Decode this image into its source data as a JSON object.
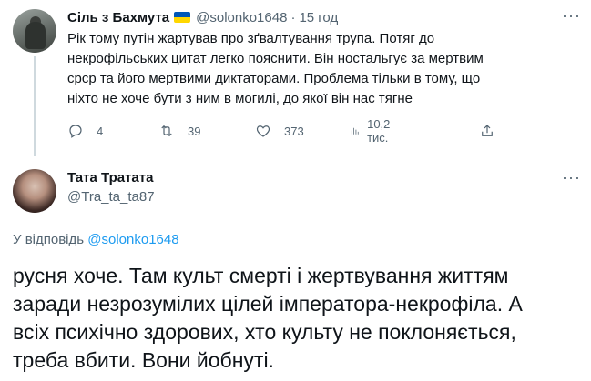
{
  "tweet1": {
    "author_name": "Сіль з Бахмута",
    "handle": "@solonko1648",
    "separator": "·",
    "time": "15 год",
    "more": "···",
    "text": "Рік тому путін жартував про зґвалтування трупа. Потяг до\nнекрофільських цитат легко пояснити. Він ностальгує за мертвим\nсрср та його мертвими диктаторами. Проблема тільки в тому, що\nніхто не хоче бути з ним в могилі, до якої він нас тягне",
    "stats": {
      "replies": "4",
      "retweets": "39",
      "likes": "373",
      "views": "10,2 тис."
    },
    "flag_colors": [
      "#0057b7",
      "#ffd700"
    ]
  },
  "tweet2": {
    "author_name": "Тата Тратата",
    "handle": "@Tra_ta_ta87",
    "more": "···",
    "replying_prefix": "У відповідь",
    "replying_mention": "@solonko1648",
    "text": "русня хоче. Там культ смерті і жертвування життям\nзаради незрозумілих цілей імператора-некрофіла. А\nвсіх психічно здорових, хто культу не поклоняється,\nтреба вбити. Вони йобнуті."
  },
  "colors": {
    "text": "#0f1419",
    "secondary": "#536471",
    "link": "#1d9bf0",
    "line": "#cfd9de"
  }
}
